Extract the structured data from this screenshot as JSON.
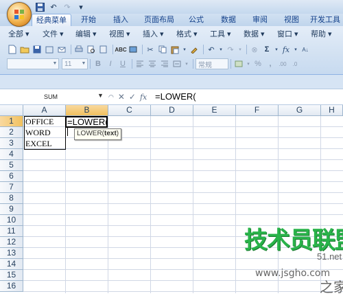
{
  "qat": {
    "undo": "↶",
    "redo": "↷",
    "customize": "▾"
  },
  "tabs": [
    "经典菜单",
    "开始",
    "插入",
    "页面布局",
    "公式",
    "数据",
    "审阅",
    "视图",
    "开发工具"
  ],
  "menus": [
    "全部",
    "文件",
    "编辑",
    "视图",
    "插入",
    "格式",
    "工具",
    "数据",
    "窗口",
    "帮助"
  ],
  "toolbar": {
    "font_size": "11",
    "number_format": "常规",
    "bold": "B",
    "italic": "I",
    "underline": "U",
    "percent": "%",
    "comma": ",",
    "sigma": "Σ",
    "fx": "fx"
  },
  "formula_bar": {
    "name_box": "SUM",
    "cancel": "✕",
    "enter": "✓",
    "fx": "fx",
    "content": "=LOWER("
  },
  "columns": [
    "A",
    "B",
    "C",
    "D",
    "E",
    "F",
    "G",
    "H"
  ],
  "rows": [
    "1",
    "2",
    "3",
    "4",
    "5",
    "6",
    "7",
    "8",
    "9",
    "10",
    "11",
    "12",
    "13",
    "14",
    "15",
    "16"
  ],
  "cells": {
    "A1": "OFFICE",
    "A2": "WORD",
    "A3": "EXCEL",
    "B1": "=LOWER("
  },
  "tooltip": {
    "func": "LOWER(",
    "arg": "text",
    "close": ")"
  },
  "watermark": {
    "main": "技术员联盟",
    "sub": "www.jsgho.com",
    "side": "51.net",
    "side2": "之家"
  }
}
